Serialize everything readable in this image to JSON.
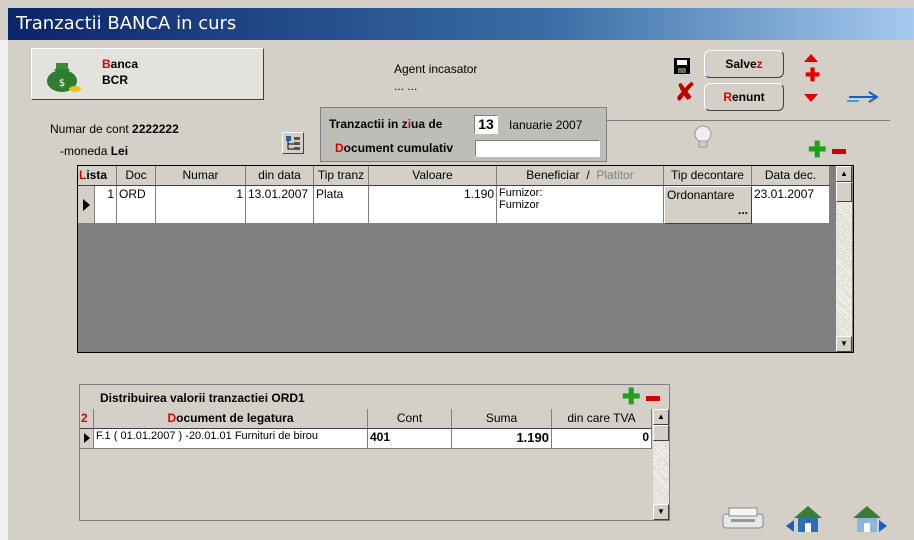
{
  "window": {
    "title": "Tranzactii BANCA in curs"
  },
  "bank": {
    "label_first": "B",
    "label_rest": "anca",
    "name": "BCR"
  },
  "agent": {
    "label": "Agent incasator",
    "value": "... ..."
  },
  "buttons": {
    "save_first": "Salve",
    "save_hot": "z",
    "cancel_hot": "R",
    "cancel_rest": "enunt"
  },
  "account": {
    "label": "Numar de cont",
    "number": "2222222",
    "currency_label": "-moneda",
    "currency": "Lei"
  },
  "day_panel": {
    "label_a": "Tranzactii in z",
    "label_hot": "i",
    "label_b": "ua de",
    "day": "13",
    "month_year": "Ianuarie 2007",
    "cum_a": "D",
    "cum_b": "o",
    "cum_c": "cument cumulativ",
    "cum_value": ""
  },
  "transactions": {
    "headers": {
      "lista_hot": "L",
      "lista_rest": "ista",
      "doc": "Doc",
      "numar": "Numar",
      "din_data": "din data",
      "tip_tranz": "Tip tranz",
      "valoare": "Valoare",
      "beneficiar": "Beneficiar",
      "slash": "/",
      "platitor": "Platitor",
      "tip_decontare": "Tip decontare",
      "data_dec": "Data dec."
    },
    "rows": [
      {
        "lista": "1",
        "doc": "ORD",
        "numar": "1",
        "din_data": "13.01.2007",
        "tip_tranz": "Plata",
        "valoare": "1.190",
        "beneficiar": "Furnizor:",
        "platitor": "Furnizor",
        "tip_decontare": "Ordonantare",
        "tip_decontare_more": "...",
        "data_dec": "23.01.2007"
      }
    ]
  },
  "distribution": {
    "title": "Distribuirea valorii tranzactiei ORD1",
    "row_num": "2",
    "headers": {
      "doc_hot": "D",
      "doc_rest": "ocument de legatura",
      "cont": "Cont",
      "suma": "Suma",
      "tva": "din care TVA"
    },
    "rows": [
      {
        "doc": "F.1 ( 01.01.2007 ) -20.01.01 Furnituri de birou",
        "cont": "401",
        "suma": "1.190",
        "tva": "0"
      }
    ]
  },
  "colors": {
    "title_bar": "#0a246a",
    "accent_red": "#e00000",
    "add_green": "#1aa31a"
  }
}
